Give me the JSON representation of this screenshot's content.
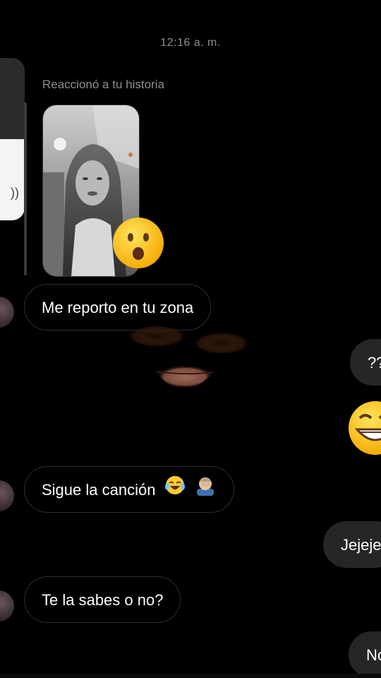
{
  "timestamp": "12:16 a. m.",
  "reaction_label": "Reaccionó a tu historia",
  "reaction_emoji": "astonished-face",
  "messages": [
    {
      "side": "left",
      "text": "Me reporto en tu zona"
    },
    {
      "side": "right",
      "text": "??"
    },
    {
      "side": "right",
      "emoji": "grinning-face-with-smiling-eyes"
    },
    {
      "side": "left",
      "text": "Sigue la canción",
      "emojis": [
        "face-with-tears-of-joy",
        "person-facepalming"
      ]
    },
    {
      "side": "right",
      "text": "Jejeje"
    },
    {
      "side": "left",
      "text": "Te la sabes o no?"
    },
    {
      "side": "right",
      "text": "No"
    }
  ],
  "colors": {
    "background": "#000000",
    "muted_text": "#8e8e8e",
    "incoming_border": "#2e2e2e",
    "outgoing_bubble": "#262626",
    "text": "#ffffff"
  }
}
